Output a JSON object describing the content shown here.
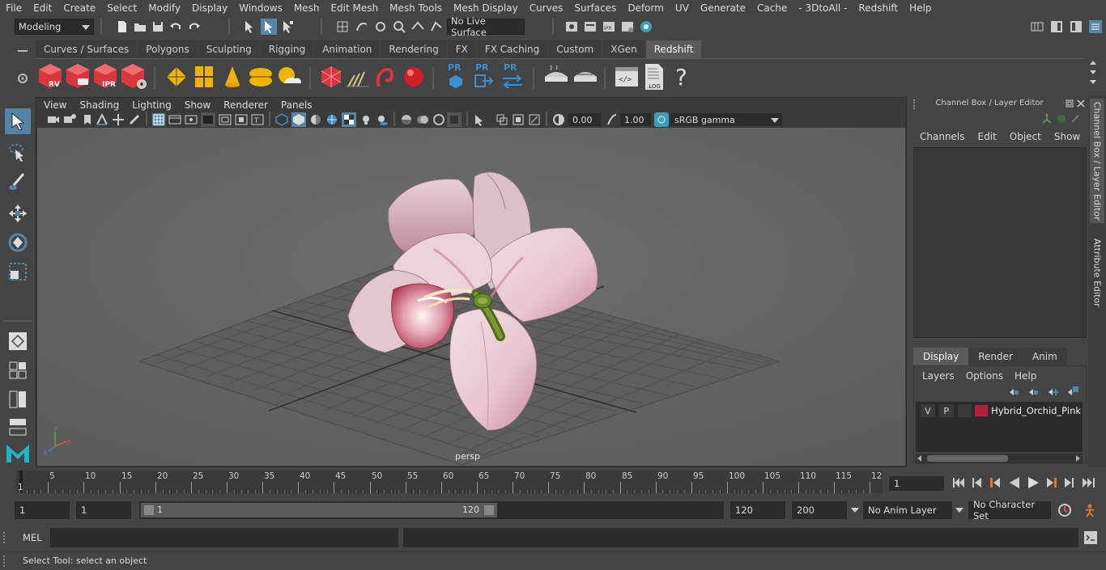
{
  "menubar": {
    "items": [
      "File",
      "Edit",
      "Create",
      "Select",
      "Modify",
      "Display",
      "Windows",
      "Mesh",
      "Edit Mesh",
      "Mesh Tools",
      "Mesh Display",
      "Curves",
      "Surfaces",
      "Deform",
      "UV",
      "Generate",
      "Cache",
      "- 3DtoAll -",
      "Redshift",
      "Help"
    ]
  },
  "statusline": {
    "mode": "Modeling",
    "live_surface": "No Live Surface"
  },
  "shelf": {
    "tabs": [
      "Curves / Surfaces",
      "Polygons",
      "Sculpting",
      "Rigging",
      "Animation",
      "Rendering",
      "FX",
      "FX Caching",
      "Custom",
      "XGen",
      "Redshift"
    ],
    "active_tab": "Redshift",
    "icon_labels": {
      "rv": "RV",
      "ipr": "IPR",
      "pr1": "PR",
      "pr2": "PR",
      "pr3": "PR",
      "log": ".LOG",
      "help": "?"
    }
  },
  "viewport": {
    "menu": [
      "View",
      "Shading",
      "Lighting",
      "Show",
      "Renderer",
      "Panels"
    ],
    "exposure": "0.00",
    "gamma": "1.00",
    "color_space": "sRGB gamma",
    "camera_label": "persp"
  },
  "channel_box": {
    "title": "Channel Box / Layer Editor",
    "menu": [
      "Channels",
      "Edit",
      "Object",
      "Show"
    ],
    "layer_tabs": [
      "Display",
      "Render",
      "Anim"
    ],
    "active_layer_tab": "Display",
    "layer_menu": [
      "Layers",
      "Options",
      "Help"
    ],
    "layer": {
      "visible": "V",
      "playback": "P",
      "name": "Hybrid_Orchid_Pink",
      "color": "#b0203a"
    }
  },
  "side_tabs": [
    "Channel Box / Layer Editor",
    "Attribute Editor"
  ],
  "timeline": {
    "tick_labels": [
      "5",
      "10",
      "15",
      "20",
      "25",
      "30",
      "35",
      "40",
      "45",
      "50",
      "55",
      "60",
      "65",
      "70",
      "75",
      "80",
      "85",
      "90",
      "95",
      "100",
      "105",
      "110",
      "115",
      "12"
    ],
    "start_label": "1",
    "current_frame": "1"
  },
  "range": {
    "start": "1",
    "inner_start": "1",
    "slider_start": "1",
    "slider_end": "120",
    "end": "120",
    "anim_end": "200",
    "anim_layer": "No Anim Layer",
    "character_set": "No Character Set"
  },
  "command_line": {
    "language": "MEL"
  },
  "help_line": {
    "text": "Select Tool: select an object"
  },
  "colors": {
    "accent": "#5285a6",
    "redshift_red": "#d9363e",
    "shelf_yellow": "#f0b400",
    "pr_blue": "#3a8fd0"
  }
}
